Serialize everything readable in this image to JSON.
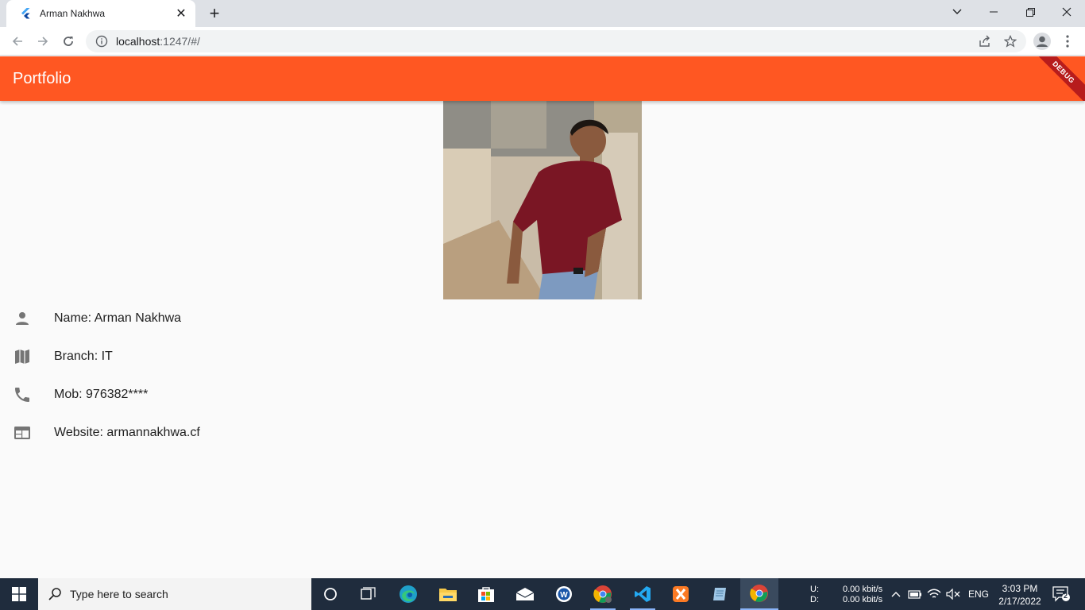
{
  "browser": {
    "tab_title": "Arman Nakhwa",
    "url_host": "localhost",
    "url_rest": ":1247/#/"
  },
  "app": {
    "title": "Portfolio",
    "debug_label": "DEBUG",
    "accent_color": "#ff5722"
  },
  "profile": {
    "items": [
      {
        "icon": "person-icon",
        "text": "Name: Arman Nakhwa"
      },
      {
        "icon": "map-icon",
        "text": "Branch: IT"
      },
      {
        "icon": "phone-icon",
        "text": "Mob: 976382****"
      },
      {
        "icon": "web-icon",
        "text": "Website: armannakhwa.cf"
      }
    ]
  },
  "taskbar": {
    "search_placeholder": "Type here to search",
    "net_u_label": "U:",
    "net_d_label": "D:",
    "net_u_value": "0.00 kbit/s",
    "net_d_value": "0.00 kbit/s",
    "language": "ENG",
    "time": "3:03 PM",
    "date": "2/17/2022",
    "notification_count": "2"
  }
}
